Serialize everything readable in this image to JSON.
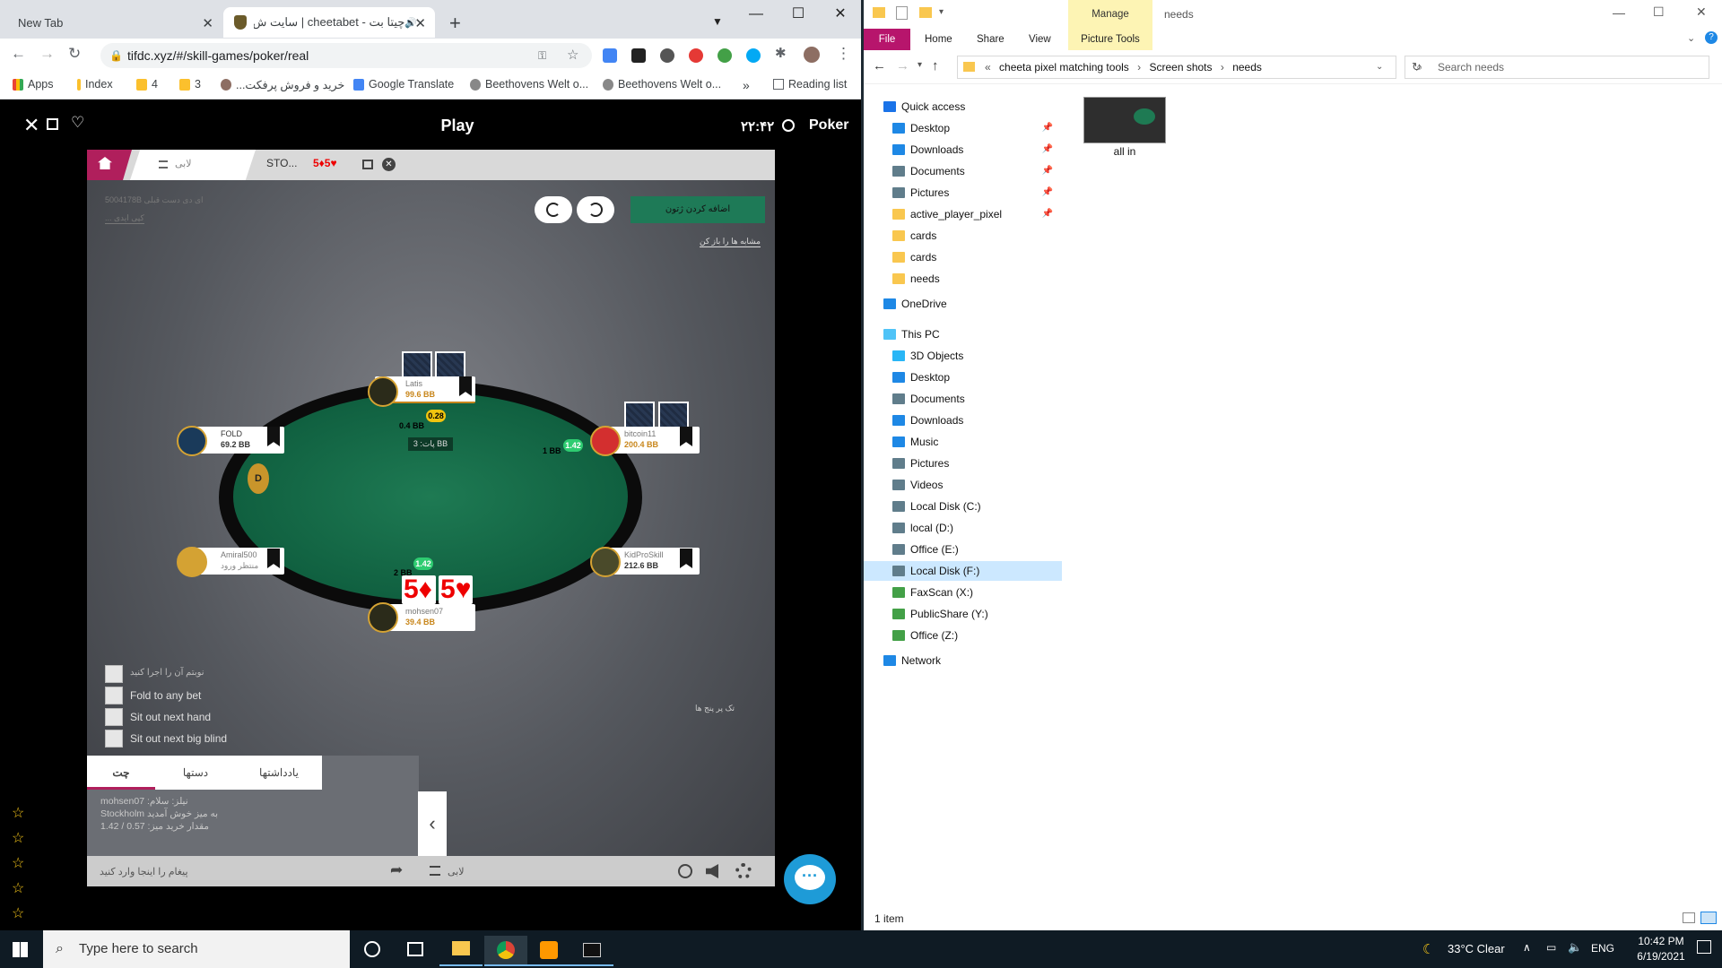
{
  "chrome": {
    "tabs": [
      {
        "title": "New Tab"
      },
      {
        "title": "چیتا بت - cheetabet | سایت ش..."
      }
    ],
    "url": "tifdc.xyz/#/skill-games/poker/real",
    "bookmarks": [
      {
        "label": "Apps",
        "color": "#ea4335"
      },
      {
        "label": "Index",
        "color": "#fbc02d"
      },
      {
        "label": "4",
        "color": "#fbc02d"
      },
      {
        "label": "3",
        "color": "#fbc02d"
      },
      {
        "label": "خرید و فروش پرفکت...",
        "color": "#8d6e63"
      },
      {
        "label": "Google Translate",
        "color": "#4285f4"
      },
      {
        "label": "Beethovens Welt o...",
        "color": "#888888"
      },
      {
        "label": "Beethovens Welt o...",
        "color": "#888888"
      }
    ],
    "more_bookmarks": "»",
    "reading_list": "Reading list"
  },
  "game": {
    "header_title": "Play",
    "clock": "۲۲:۴۲",
    "brand": "Poker",
    "tabs": {
      "lobby": "لابی",
      "table_name": "STO...",
      "stakes": "5♦5♥"
    },
    "top_left_info": [
      "5004178B ای دی دست قبلی",
      "... کپی ایدی"
    ],
    "green_button": "اضافه کردن ژتون",
    "show_cards_link": "مشابه ها را باز کن",
    "seats": [
      {
        "name": "Latis",
        "stack": "99.6 BB"
      },
      {
        "name": "FOLD",
        "stack": "69.2 BB"
      },
      {
        "name": "bitcoin11",
        "stack": "200.4 BB"
      },
      {
        "name": "Amiral500",
        "stack": "منتظر ورود"
      },
      {
        "name": "KidProSkill",
        "stack": "212.6 BB"
      },
      {
        "name": "mohsen07",
        "stack": "39.4 BB"
      }
    ],
    "bets": {
      "latis_chip": "0.28",
      "latis_bet": "0.4 BB",
      "pot": "پات: 3 BB",
      "bitcoin_chip": "1.42",
      "bitcoin_bet": "1 BB",
      "hero_chip": "1.42",
      "hero_bet": "2 BB"
    },
    "dealer": "D",
    "hero_cards": [
      "5♦",
      "5♥"
    ],
    "options": [
      "نوبتم آن را اجرا کنید",
      "Fold to any bet",
      "Sit out next hand",
      "Sit out next big blind"
    ],
    "side_note": "تک پر پنج ها",
    "chat": {
      "tabs": [
        "چت",
        "دستها",
        "یادداشتها"
      ],
      "lines": [
        "mohsen07 :نیلز: سلام",
        "Stockholm به میز خوش آمدید",
        "مقدار خرید میز: 0.57 / 1.42"
      ],
      "input_placeholder": "پیغام را اینجا وارد کنید",
      "lobby_label": "لابی"
    }
  },
  "explorer": {
    "title": "needs",
    "manage_tab": "Manage",
    "ribbon": [
      "File",
      "Home",
      "Share",
      "View",
      "Picture Tools"
    ],
    "breadcrumb": [
      "cheeta pixel matching tools",
      "Screen shots",
      "needs"
    ],
    "search_placeholder": "Search needs",
    "sidebar": [
      {
        "label": "Quick access",
        "color": "#1a73e8",
        "level": 0
      },
      {
        "label": "Desktop",
        "color": "#1e88e5",
        "level": 1,
        "pinned": true
      },
      {
        "label": "Downloads",
        "color": "#1e88e5",
        "level": 1,
        "pinned": true
      },
      {
        "label": "Documents",
        "color": "#607d8b",
        "level": 1,
        "pinned": true
      },
      {
        "label": "Pictures",
        "color": "#607d8b",
        "level": 1,
        "pinned": true
      },
      {
        "label": "active_player_pixel",
        "color": "#f9c74f",
        "level": 1,
        "pinned": true
      },
      {
        "label": "cards",
        "color": "#f9c74f",
        "level": 1
      },
      {
        "label": "cards",
        "color": "#f9c74f",
        "level": 1
      },
      {
        "label": "needs",
        "color": "#f9c74f",
        "level": 1
      },
      {
        "label": "OneDrive",
        "color": "#1e88e5",
        "level": 0
      },
      {
        "label": "This PC",
        "color": "#4fc3f7",
        "level": 0
      },
      {
        "label": "3D Objects",
        "color": "#29b6f6",
        "level": 1
      },
      {
        "label": "Desktop",
        "color": "#1e88e5",
        "level": 1
      },
      {
        "label": "Documents",
        "color": "#607d8b",
        "level": 1
      },
      {
        "label": "Downloads",
        "color": "#1e88e5",
        "level": 1
      },
      {
        "label": "Music",
        "color": "#1e88e5",
        "level": 1
      },
      {
        "label": "Pictures",
        "color": "#607d8b",
        "level": 1
      },
      {
        "label": "Videos",
        "color": "#607d8b",
        "level": 1
      },
      {
        "label": "Local Disk (C:)",
        "color": "#607d8b",
        "level": 1
      },
      {
        "label": "local (D:)",
        "color": "#607d8b",
        "level": 1
      },
      {
        "label": "Office (E:)",
        "color": "#607d8b",
        "level": 1
      },
      {
        "label": "Local Disk (F:)",
        "color": "#607d8b",
        "level": 1,
        "selected": true
      },
      {
        "label": "FaxScan (X:)",
        "color": "#43a047",
        "level": 1
      },
      {
        "label": "PublicShare (Y:)",
        "color": "#43a047",
        "level": 1
      },
      {
        "label": "Office (Z:)",
        "color": "#43a047",
        "level": 1
      },
      {
        "label": "Network",
        "color": "#1e88e5",
        "level": 0
      }
    ],
    "file": {
      "name": "all in"
    },
    "status": "1 item"
  },
  "taskbar": {
    "search_placeholder": "Type here to search",
    "weather": "33°C  Clear",
    "lang": "ENG",
    "time": "10:42 PM",
    "date": "6/19/2021"
  }
}
